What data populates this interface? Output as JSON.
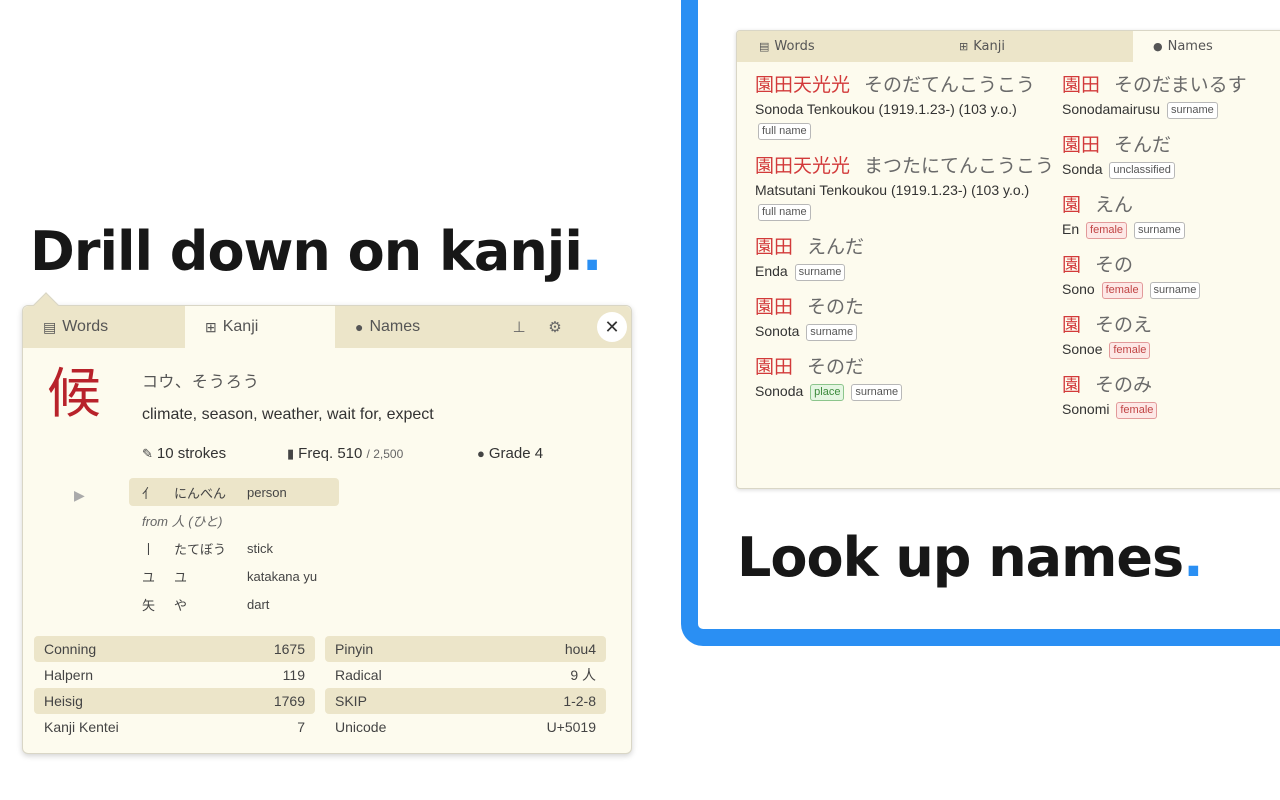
{
  "headlines": {
    "names_text": "Look up names",
    "kanji_text": "Drill down on kanji",
    "dot": "."
  },
  "names_popup": {
    "tabs": [
      {
        "label": "Words",
        "icon": "book-icon"
      },
      {
        "label": "Kanji",
        "icon": "kanji-icon"
      },
      {
        "label": "Names",
        "icon": "person-icon"
      }
    ],
    "left_entries": [
      {
        "kanji": "園田天光光",
        "kana": "そのだてんこうこう",
        "romaji": "Sonoda Tenkoukou (1919.1.23-) (103 y.o.)",
        "tags": [
          "full name"
        ]
      },
      {
        "kanji": "園田天光光",
        "kana": "まつたにてんこうこう",
        "romaji": "Matsutani Tenkoukou (1919.1.23-) (103 y.o.)",
        "tags": [
          "full name"
        ]
      },
      {
        "kanji": "園田",
        "kana": "えんだ",
        "romaji": "Enda",
        "tags": [
          "surname"
        ]
      },
      {
        "kanji": "園田",
        "kana": "そのた",
        "romaji": "Sonota",
        "tags": [
          "surname"
        ]
      },
      {
        "kanji": "園田",
        "kana": "そのだ",
        "romaji": "Sonoda",
        "tags": [
          "place",
          "surname"
        ]
      }
    ],
    "right_entries": [
      {
        "kanji": "園田",
        "kana": "そのだまいるす",
        "romaji": "Sonodamairusu",
        "tags": [
          "surname"
        ]
      },
      {
        "kanji": "園田",
        "kana": "そんだ",
        "romaji": "Sonda",
        "tags": [
          "unclassified"
        ]
      },
      {
        "kanji": "園",
        "kana": "えん",
        "romaji": "En",
        "tags": [
          "female",
          "surname"
        ]
      },
      {
        "kanji": "園",
        "kana": "その",
        "romaji": "Sono",
        "tags": [
          "female",
          "surname"
        ]
      },
      {
        "kanji": "園",
        "kana": "そのえ",
        "romaji": "Sonoe",
        "tags": [
          "female"
        ]
      },
      {
        "kanji": "園",
        "kana": "そのみ",
        "romaji": "Sonomi",
        "tags": [
          "female"
        ]
      }
    ]
  },
  "kanji_popup": {
    "tabs": {
      "words": "Words",
      "kanji": "Kanji",
      "names": "Names"
    },
    "icons": [
      "pin-icon",
      "settings-icon",
      "close-icon"
    ],
    "kanji": "候",
    "readings": "コウ、そうろう",
    "meanings": "climate, season, weather, wait for, expect",
    "strokes": "10 strokes",
    "freq": "Freq. 510",
    "freq_total": "/ 2,500",
    "grade": "Grade 4",
    "components": {
      "first": {
        "radical": "亻",
        "reading": "にんべん",
        "meaning": "person"
      },
      "from": "from 人 (ひと)",
      "rest": [
        {
          "radical": "丨",
          "reading": "たてぼう",
          "meaning": "stick"
        },
        {
          "radical": "ユ",
          "reading": "ユ",
          "meaning": "katakana yu"
        },
        {
          "radical": "矢",
          "reading": "や",
          "meaning": "dart"
        }
      ]
    },
    "references_left": [
      {
        "label": "Conning",
        "value": "1675"
      },
      {
        "label": "Halpern",
        "value": "119"
      },
      {
        "label": "Heisig",
        "value": "1769"
      },
      {
        "label": "Kanji Kentei",
        "value": "7"
      }
    ],
    "references_right": [
      {
        "label": "Pinyin",
        "value": "hou4"
      },
      {
        "label": "Radical",
        "value": "9 人"
      },
      {
        "label": "SKIP",
        "value": "1-2-8"
      },
      {
        "label": "Unicode",
        "value": "U+5019"
      }
    ]
  }
}
